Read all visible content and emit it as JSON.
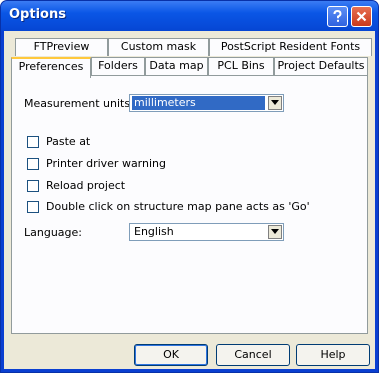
{
  "window": {
    "title": "Options",
    "help_glyph": "?",
    "close_glyph": "×"
  },
  "tabs": {
    "row1": [
      "FTPreview",
      "Custom mask",
      "PostScript Resident Fonts"
    ],
    "row2": [
      "Preferences",
      "Folders",
      "Data map",
      "PCL Bins",
      "Project Defaults"
    ],
    "active": "Preferences"
  },
  "preferences": {
    "measurement_units_label": "Measurement units:",
    "measurement_units_value": "millimeters",
    "checkboxes": [
      {
        "label": "Paste at",
        "checked": false
      },
      {
        "label": "Printer driver warning",
        "checked": false
      },
      {
        "label": "Reload project",
        "checked": false
      },
      {
        "label": "Double click on structure map pane acts as 'Go'",
        "checked": false
      }
    ],
    "language_label": "Language:",
    "language_value": "English"
  },
  "buttons": {
    "ok": "OK",
    "cancel": "Cancel",
    "help": "Help"
  }
}
